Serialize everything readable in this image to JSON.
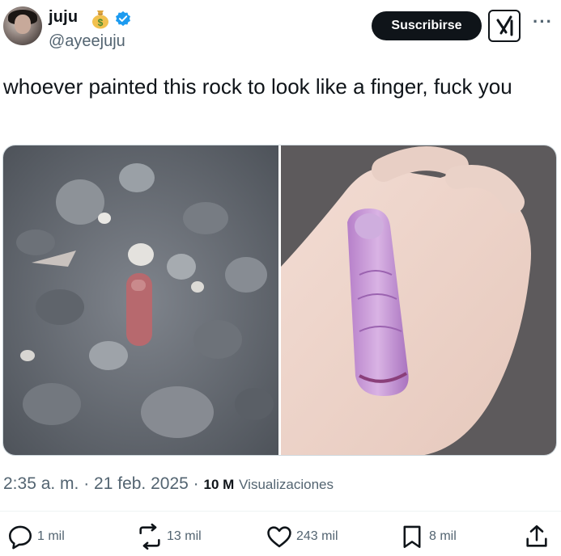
{
  "author": {
    "name": "juju",
    "handle": "@ayeejuju",
    "emoji_icon": "money-bag-icon",
    "verified_icon": "verified-badge-icon"
  },
  "header_actions": {
    "subscribe_label": "Suscribirse",
    "grok_icon": "grok-icon",
    "more_icon": "more-dots-icon"
  },
  "tweet": {
    "text": "whoever painted this rock to look like a finger, fuck you"
  },
  "media": {
    "left_image": "rock-on-pebbles-photo",
    "right_image": "rock-in-hand-photo"
  },
  "meta": {
    "time_date": "2:35 a. m. · 21 feb. 2025 ·",
    "views_count": "10 M",
    "views_label": "Visualizaciones"
  },
  "actions": {
    "replies": "1 mil",
    "reposts": "13 mil",
    "likes": "243 mil",
    "bookmarks": "8 mil"
  },
  "colors": {
    "text_primary": "#0f1419",
    "text_secondary": "#536471",
    "verified_blue": "#1d9bf0",
    "button_bg": "#0f1419"
  }
}
